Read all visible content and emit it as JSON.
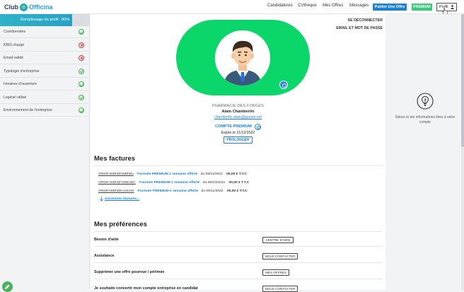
{
  "header": {
    "logo_left": "Club",
    "logo_right": "Officina",
    "nav": [
      "Candidatures",
      "CVthèque",
      "Mes Offres",
      "Messages"
    ],
    "publish_label": "Publier Une Offre",
    "premium_label": "PREMIUM",
    "profile_label": "Profil"
  },
  "sidebar": {
    "progress_label": "Remplissage du profil : 80%",
    "progress_fraction": 0.8,
    "steps": [
      {
        "label": "Coordonnées",
        "status": "ok"
      },
      {
        "label": "KBIS chargé",
        "status": "ko"
      },
      {
        "label": "Email validé",
        "status": "ko"
      },
      {
        "label": "Typologie d'entreprise",
        "status": "ok"
      },
      {
        "label": "Horaires d'ouverture",
        "status": "ok"
      },
      {
        "label": "Logiciel utilisé",
        "status": "ok"
      },
      {
        "label": "Environnement de l'entreprise",
        "status": "ok"
      }
    ]
  },
  "profile": {
    "disconnect_label": "SE DÉCONNECTER",
    "email_pw_label": "EMAIL ET MOT DE PASSE",
    "pharmacy": "PHARMACIE DES FORGES",
    "name": "Alain Chamberlin",
    "email": "chamberlin.alain@gosste.net",
    "account_type": "COMPTE PREMIUM",
    "expiry": "Expire le 21/12/2022",
    "extend_label": "PROLONGER",
    "brand_color": "#0ad66a"
  },
  "invoices": {
    "title": "Mes factures",
    "rows": [
      {
        "code": "ORDR-WBhDFWBhBo",
        "label": "Formule PREMIUM 1 semaine offerte",
        "date": "du 09/11/2022",
        "amount": "00,00 € T.T.C"
      },
      {
        "code": "ORDR-WBhDFS9BUBC",
        "label": "Formule PREMIUM 1 semaine offerte",
        "date": "du 09/10/2022",
        "amount": "00,00 € T.T.C"
      },
      {
        "code": "ORDR-WBhDEAAE1tS",
        "label": "Formule PREMIUM 1 semaine offerte",
        "date": "du 09/11/2022",
        "amount": "00,00 € T.T.C"
      }
    ],
    "older_label": "Anciennes factures..."
  },
  "preferences": {
    "title": "Mes préférences",
    "rows": [
      {
        "label": "Besoin d'aide",
        "button": "CENTRE D'AIDE"
      },
      {
        "label": "Assistance",
        "button": "NOUS CONTACTER"
      },
      {
        "label": "Supprimer une offre pourvue / périmée",
        "button": "MES OFFRES"
      },
      {
        "label": "Je souhaite convertir mon compte entreprise en candidat",
        "button": "NOUS CONTACTER"
      }
    ]
  },
  "right_panel": {
    "text": "Gérez ici les informations liées à votre compte"
  }
}
